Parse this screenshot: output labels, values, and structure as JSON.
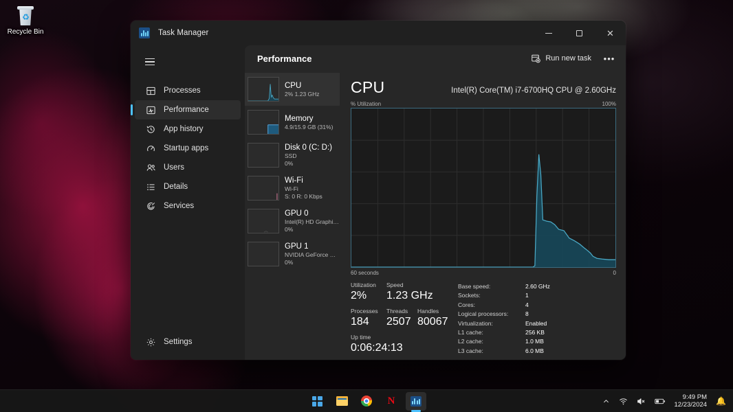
{
  "desktop": {
    "recycle_bin": {
      "label": "Recycle Bin",
      "icon": "recycle-bin-icon"
    }
  },
  "window": {
    "title": "Task Manager",
    "app_icon": "task-manager-icon",
    "controls": {
      "minimize": "minimize",
      "maximize": "maximize",
      "close": "close"
    }
  },
  "sidebar": {
    "menu_icon": "hamburger-icon",
    "items": [
      {
        "label": "Processes",
        "icon": "processes-icon",
        "active": false
      },
      {
        "label": "Performance",
        "icon": "performance-icon",
        "active": true
      },
      {
        "label": "App history",
        "icon": "history-icon",
        "active": false
      },
      {
        "label": "Startup apps",
        "icon": "startup-icon",
        "active": false
      },
      {
        "label": "Users",
        "icon": "users-icon",
        "active": false
      },
      {
        "label": "Details",
        "icon": "details-icon",
        "active": false
      },
      {
        "label": "Services",
        "icon": "services-icon",
        "active": false
      }
    ],
    "settings": {
      "label": "Settings",
      "icon": "gear-icon"
    }
  },
  "header": {
    "page_title": "Performance",
    "run_new_task": {
      "label": "Run new task",
      "icon": "run-new-task-icon"
    },
    "more_options": "•••"
  },
  "resources": [
    {
      "name": "CPU",
      "line1": "2%  1.23 GHz",
      "line2": "",
      "active": true
    },
    {
      "name": "Memory",
      "line1": "4.9/15.9 GB (31%)",
      "line2": "",
      "active": false
    },
    {
      "name": "Disk 0 (C: D:)",
      "line1": "SSD",
      "line2": "0%",
      "active": false
    },
    {
      "name": "Wi-Fi",
      "line1": "Wi-Fi",
      "line2": "S: 0 R: 0 Kbps",
      "active": false
    },
    {
      "name": "GPU 0",
      "line1": "Intel(R) HD Graphics …",
      "line2": "0%",
      "active": false
    },
    {
      "name": "GPU 1",
      "line1": "NVIDIA GeForce GTX…",
      "line2": "0%",
      "active": false
    }
  ],
  "detail": {
    "heading": "CPU",
    "model": "Intel(R) Core(TM) i7-6700HQ CPU @ 2.60GHz",
    "graph_top_left": "% Utilization",
    "graph_top_right": "100%",
    "graph_bottom_left": "60 seconds",
    "graph_bottom_right": "0",
    "stats": [
      {
        "label": "Utilization",
        "value": "2%"
      },
      {
        "label": "Speed",
        "value": "1.23 GHz"
      },
      {
        "label": "Processes",
        "value": "184"
      },
      {
        "label": "Threads",
        "value": "2507"
      },
      {
        "label": "Handles",
        "value": "80067"
      },
      {
        "label": "Up time",
        "value": "0:06:24:13"
      }
    ],
    "specs": [
      {
        "key": "Base speed:",
        "value": "2.60 GHz"
      },
      {
        "key": "Sockets:",
        "value": "1"
      },
      {
        "key": "Cores:",
        "value": "4"
      },
      {
        "key": "Logical processors:",
        "value": "8"
      },
      {
        "key": "Virtualization:",
        "value": "Enabled"
      },
      {
        "key": "L1 cache:",
        "value": "256 KB"
      },
      {
        "key": "L2 cache:",
        "value": "1.0 MB"
      },
      {
        "key": "L3 cache:",
        "value": "6.0 MB"
      }
    ]
  },
  "chart_data": {
    "type": "area",
    "title": "% Utilization",
    "xlabel": "60 seconds",
    "ylabel": "% Utilization",
    "ylim": [
      0,
      100
    ],
    "xlim": [
      60,
      0
    ],
    "grid": true,
    "legend": null,
    "line_color": "#4aa9c6",
    "fill_color": "#17485a",
    "x": [
      60,
      58,
      56,
      54,
      52,
      50,
      48,
      46,
      44,
      42,
      40,
      38,
      36,
      34,
      32,
      30,
      28,
      26,
      24,
      22,
      20,
      18,
      17,
      16.5,
      16,
      15.5,
      15,
      14,
      13,
      12,
      11,
      10,
      9,
      8,
      7,
      6,
      5,
      4,
      3,
      2,
      1,
      0
    ],
    "values": [
      0,
      0,
      0,
      0,
      0,
      0,
      0,
      0,
      0,
      0,
      0,
      0,
      0,
      0,
      0,
      0,
      0,
      0,
      0,
      0,
      0,
      1,
      42,
      72,
      70,
      30,
      25,
      24,
      23,
      22,
      20,
      18,
      15,
      13,
      11,
      9,
      7,
      6,
      5,
      4,
      3,
      3
    ]
  },
  "taskbar": {
    "apps": [
      {
        "name": "start-button",
        "icon": "windows-start-icon",
        "running": false
      },
      {
        "name": "file-explorer",
        "icon": "folder-icon",
        "running": false
      },
      {
        "name": "google-chrome",
        "icon": "chrome-icon",
        "running": false
      },
      {
        "name": "netflix",
        "icon": "netflix-icon",
        "running": false
      },
      {
        "name": "task-manager",
        "icon": "task-manager-icon",
        "running": true
      }
    ],
    "tray": {
      "chevron": "show-hidden-icons",
      "network": "wifi-icon",
      "volume": "volume-muted-icon",
      "battery": "battery-icon",
      "time": "9:49 PM",
      "date": "12/23/2024",
      "notifications": "notification-bell-icon"
    }
  }
}
